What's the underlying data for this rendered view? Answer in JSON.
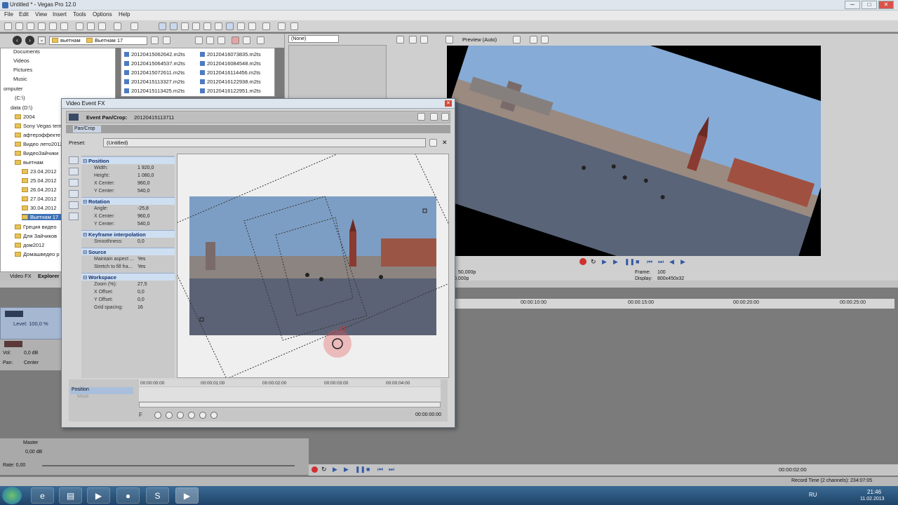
{
  "window": {
    "title": "Untitled * - Vegas Pro 12.0",
    "min": "─",
    "max": "□",
    "close": "✕"
  },
  "menu": [
    "File",
    "Edit",
    "View",
    "Insert",
    "Tools",
    "Options",
    "Help"
  ],
  "explorer": {
    "path_folder": "вьетнам",
    "path_sub": "Вьетнам 17",
    "tree": [
      "Documents",
      "Videos",
      "Pictures",
      "Music",
      "omputer",
      "(C:\\)",
      "data (D:\\)",
      "2004",
      "Sony Vegas tem",
      "афтерэффекте",
      "Видео лето2012",
      "ВидеоЗайчики",
      "вьетнам",
      "23.04.2012",
      "25.04.2012",
      "26.04.2012",
      "27.04.2012",
      "30.04.2012",
      "Вьетнам 17",
      "Греция видео",
      "Для Зайчиков",
      "дом2012",
      "Домашведео р"
    ],
    "files_col1": [
      "20120415062642.m2ts",
      "20120415064537.m2ts",
      "20120415072611.m2ts",
      "20120415113327.m2ts",
      "20120415113425.m2ts"
    ],
    "files_col2": [
      "20120416073835.m2ts",
      "20120416084548.m2ts",
      "20120416114456.m2ts",
      "20120416122938.m2ts",
      "20120416122951.m2ts"
    ],
    "tabs": [
      "Video FX",
      "Explorer"
    ]
  },
  "trimmer": {
    "select": "(None)"
  },
  "preview": {
    "mode": "Preview (Auto)",
    "project_label": "50,000p",
    "project_label2": "0,000p",
    "frame_label": "Frame:",
    "frame_value": "100",
    "display_label": "Display:",
    "display_value": "800x450x32"
  },
  "timeline": {
    "ruler": [
      "00:00:10:00",
      "00:00:15:00",
      "00:00:20:00",
      "00:00:25:00"
    ],
    "track1_level": "Level: 100,0 %",
    "track2_vol_label": "Vol:",
    "track2_vol": "0,0 dB",
    "track2_pan_label": "Pan:",
    "track2_pan": "Center",
    "master_label": "Master",
    "master_vol": "0,00 dB",
    "rate": "Rate: 0,00",
    "timecode": "00:00:02:00",
    "record_time": "Record Time (2 channels): 234:07:05"
  },
  "dialog": {
    "title": "Video Event FX",
    "fx_label": "Event Pan/Crop:",
    "fx_name": "20120415113711",
    "chain_item": "Pan/Crop",
    "preset_label": "Preset:",
    "preset_value": "(Untitled)",
    "props": {
      "position": {
        "header": "Position",
        "width_k": "Width:",
        "width": "1 920,0",
        "height_k": "Height:",
        "height": "1 080,0",
        "xc_k": "X Center:",
        "xc": "960,0",
        "yc_k": "Y Center:",
        "yc": "540,0"
      },
      "rotation": {
        "header": "Rotation",
        "angle_k": "Angle:",
        "angle": "-25,8",
        "xc_k": "X Center:",
        "xc": "960,0",
        "yc_k": "Y Center:",
        "yc": "540,0"
      },
      "keyframe": {
        "header": "Keyframe interpolation",
        "smooth_k": "Smoothness:",
        "smooth": "0,0"
      },
      "source": {
        "header": "Source",
        "aspect_k": "Maintain aspect ...",
        "aspect": "Yes",
        "stretch_k": "Stretch to fill fra...",
        "stretch": "Yes"
      },
      "workspace": {
        "header": "Workspace",
        "zoom_k": "Zoom (%):",
        "zoom": "27,5",
        "xo_k": "X Offset:",
        "xo": "0,0",
        "yo_k": "Y Offset:",
        "yo": "0,0",
        "grid_k": "Grid spacing:",
        "grid": "16"
      }
    },
    "kf_ruler": [
      "00:00:00:00",
      "00:00:01:00",
      "00:00:02:00",
      "00:00:03:00",
      "00:00:04:00"
    ],
    "kf_tracks": [
      "Position",
      "Mask"
    ],
    "kf_time": "00:00:00:00",
    "handle_f": "F"
  },
  "taskbar": {
    "lang": "RU",
    "time": "21:46",
    "date": "11.02.2013"
  },
  "colors": {
    "accent": "#3f73b8",
    "record": "#d03030",
    "sky": "#86abd6"
  }
}
